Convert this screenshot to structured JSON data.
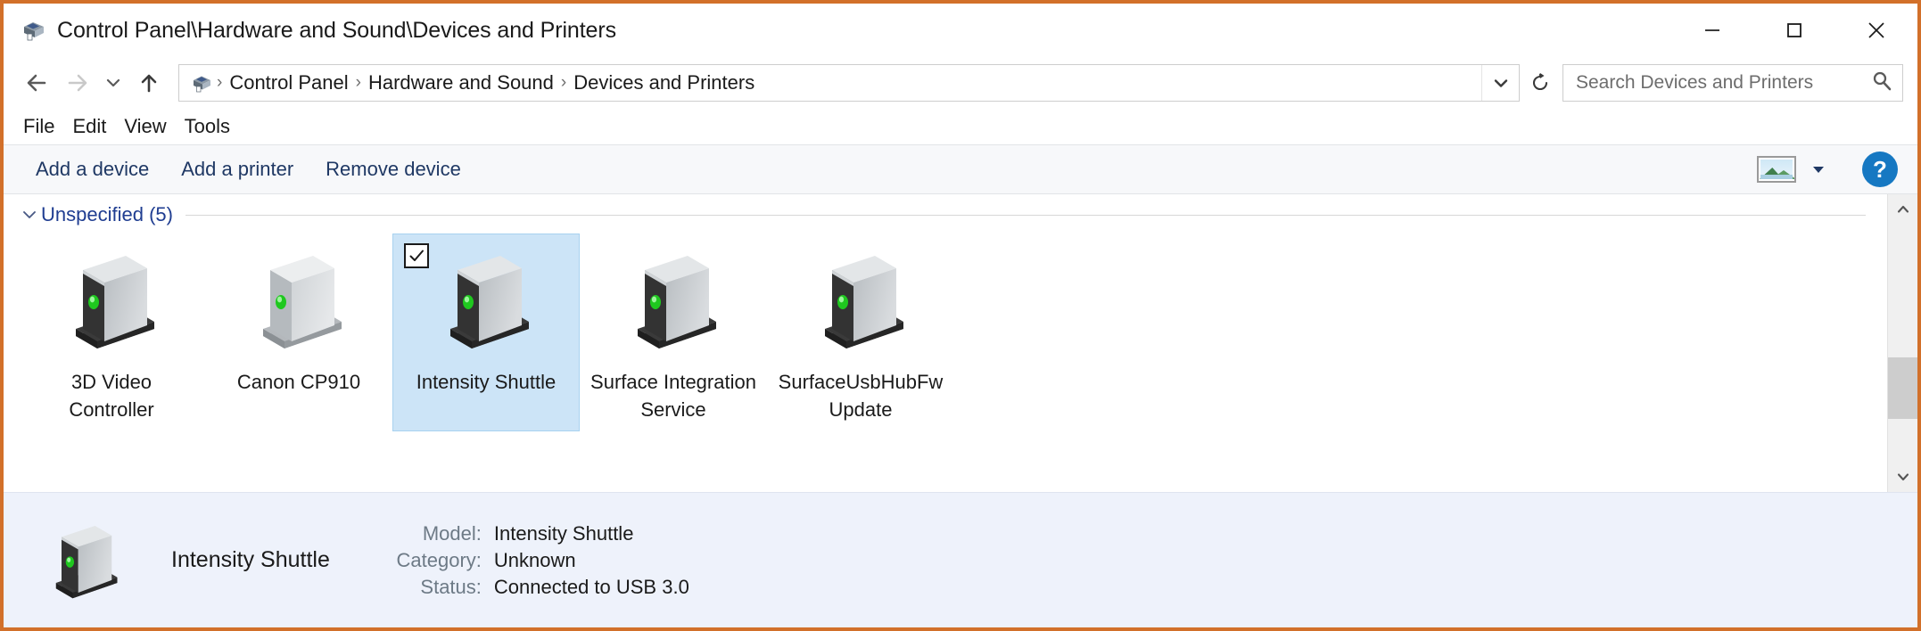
{
  "window": {
    "title": "Control Panel\\Hardware and Sound\\Devices and Printers",
    "title_icon": "printer-icon",
    "minimize_label": "—",
    "maximize_label": "□",
    "close_label": "✕"
  },
  "nav": {
    "back": "back-arrow",
    "forward": "forward-arrow",
    "recent": "chevron-down",
    "up": "up-arrow",
    "refresh": "refresh-icon",
    "address_dropdown": "chevron-down"
  },
  "breadcrumb": {
    "icon": "printer-icon",
    "items": [
      "Control Panel",
      "Hardware and Sound",
      "Devices and Printers"
    ],
    "separator": "›"
  },
  "search": {
    "placeholder": "Search Devices and Printers",
    "value": "",
    "icon": "search-icon"
  },
  "menubar": {
    "items": [
      "File",
      "Edit",
      "View",
      "Tools"
    ]
  },
  "commandbar": {
    "buttons": [
      "Add a device",
      "Add a printer",
      "Remove device"
    ],
    "view_icon": "picture-view-icon",
    "view_dropdown": "chevron-down-icon",
    "help_label": "?",
    "accent_blue": "#1678c2",
    "link_blue": "#1f3864"
  },
  "group": {
    "chevron": "chevron-down-icon",
    "label": "Unspecified (5)"
  },
  "devices": [
    {
      "name": "3D Video Controller",
      "icon": "device-dark-front-icon",
      "selected": false,
      "checked": false
    },
    {
      "name": "Canon CP910",
      "icon": "device-light-front-icon",
      "selected": false,
      "checked": false
    },
    {
      "name": "Intensity Shuttle",
      "icon": "device-dark-front-icon",
      "selected": true,
      "checked": true
    },
    {
      "name": "Surface Integration Service",
      "icon": "device-dark-front-icon",
      "selected": false,
      "checked": false
    },
    {
      "name": "SurfaceUsbHubFwUpdate",
      "icon": "device-dark-front-icon",
      "selected": false,
      "checked": false
    }
  ],
  "scrollbar": {
    "up_arrow": "chevron-up-icon",
    "down_arrow": "chevron-down-icon"
  },
  "details": {
    "icon": "device-dark-front-icon",
    "title": "Intensity Shuttle",
    "rows": [
      {
        "label": "Model:",
        "value": "Intensity Shuttle"
      },
      {
        "label": "Category:",
        "value": "Unknown"
      },
      {
        "label": "Status:",
        "value": "Connected to USB 3.0"
      }
    ]
  },
  "colors": {
    "selection_bg": "#cce4f7",
    "details_bg": "#eef2fb",
    "group_label": "#1f3d91",
    "led_green": "#22cc22"
  }
}
